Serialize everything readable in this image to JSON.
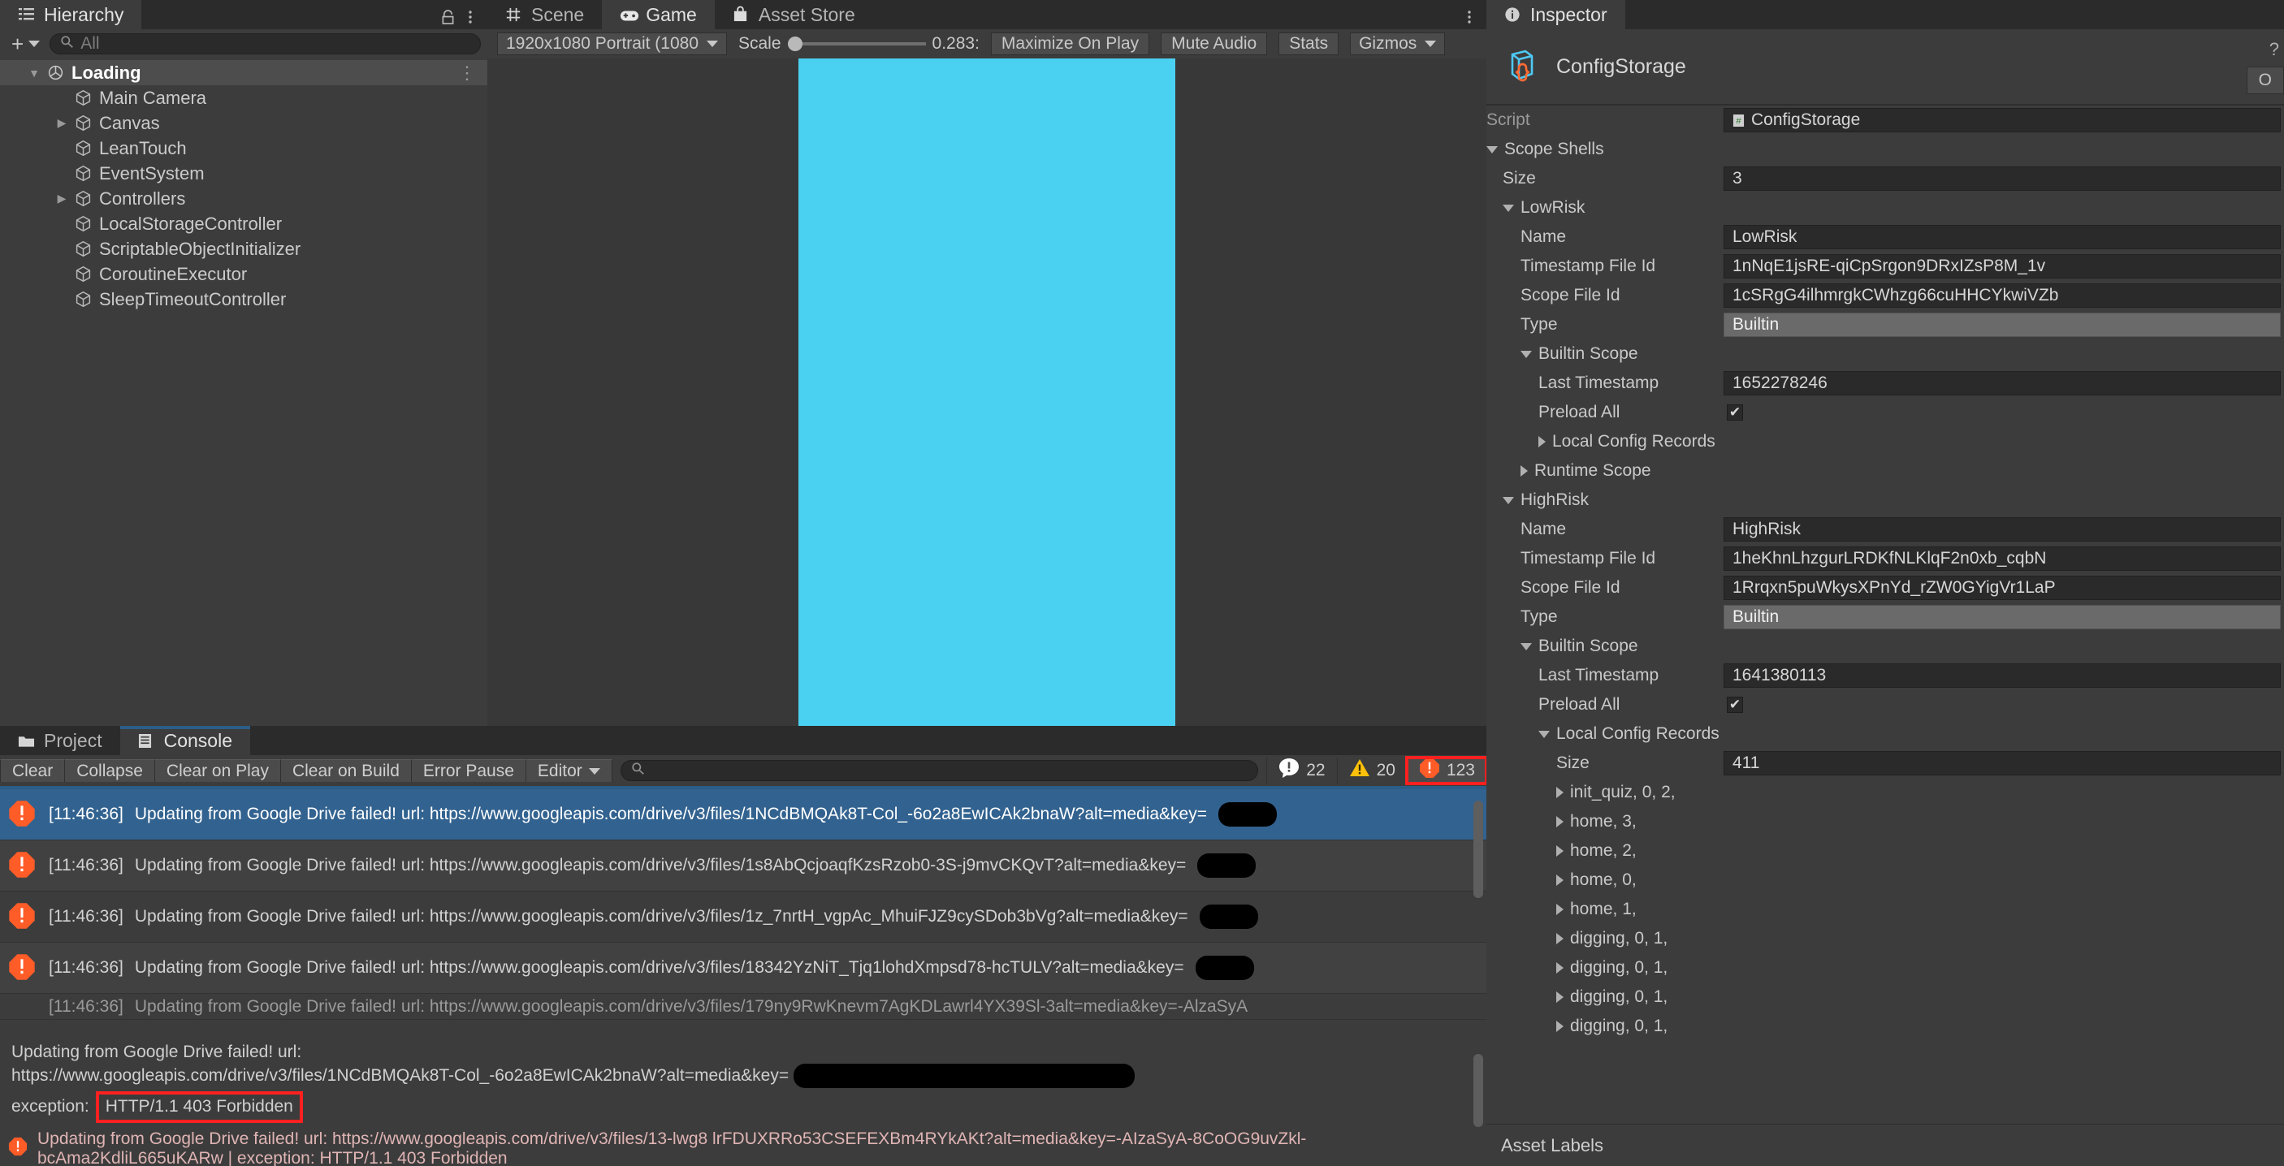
{
  "hierarchy": {
    "tab_label": "Hierarchy",
    "search_placeholder": "All",
    "add_label": "+",
    "items": [
      {
        "label": "Loading",
        "depth": 0,
        "selected": true,
        "expanded": true,
        "has_children": true,
        "icon": "unity-prefab-icon"
      },
      {
        "label": "Main Camera",
        "depth": 1,
        "selected": false,
        "expanded": false,
        "has_children": false,
        "icon": "gameobject-icon"
      },
      {
        "label": "Canvas",
        "depth": 1,
        "selected": false,
        "expanded": false,
        "has_children": true,
        "icon": "gameobject-icon"
      },
      {
        "label": "LeanTouch",
        "depth": 1,
        "selected": false,
        "expanded": false,
        "has_children": false,
        "icon": "gameobject-icon"
      },
      {
        "label": "EventSystem",
        "depth": 1,
        "selected": false,
        "expanded": false,
        "has_children": false,
        "icon": "gameobject-icon"
      },
      {
        "label": "Controllers",
        "depth": 1,
        "selected": false,
        "expanded": false,
        "has_children": true,
        "icon": "gameobject-icon"
      },
      {
        "label": "LocalStorageController",
        "depth": 1,
        "selected": false,
        "expanded": false,
        "has_children": false,
        "icon": "gameobject-icon"
      },
      {
        "label": "ScriptableObjectInitializer",
        "depth": 1,
        "selected": false,
        "expanded": false,
        "has_children": false,
        "icon": "gameobject-icon"
      },
      {
        "label": "CoroutineExecutor",
        "depth": 1,
        "selected": false,
        "expanded": false,
        "has_children": false,
        "icon": "gameobject-icon"
      },
      {
        "label": "SleepTimeoutController",
        "depth": 1,
        "selected": false,
        "expanded": false,
        "has_children": false,
        "icon": "gameobject-icon"
      }
    ]
  },
  "center": {
    "tabs": [
      {
        "label": "Scene",
        "icon": "grid-icon",
        "active": false
      },
      {
        "label": "Game",
        "icon": "gamepad-icon",
        "active": true
      },
      {
        "label": "Asset Store",
        "icon": "store-bag-icon",
        "active": false
      }
    ],
    "toolbar": {
      "resolution": "1920x1080 Portrait (1080",
      "scale_label": "Scale",
      "scale_value": "0.283:",
      "maximize_on_play": "Maximize On Play",
      "mute_audio": "Mute Audio",
      "stats": "Stats",
      "gizmos": "Gizmos"
    },
    "game_canvas_color": "#4ad0f0"
  },
  "console": {
    "tabs": [
      {
        "label": "Project",
        "icon": "folder-icon",
        "active": false
      },
      {
        "label": "Console",
        "icon": "console-lines-icon",
        "active": true
      }
    ],
    "buttons": [
      "Clear",
      "Collapse",
      "Clear on Play",
      "Clear on Build",
      "Error Pause"
    ],
    "editor_dropdown": "Editor",
    "search_placeholder": "",
    "counts": {
      "info": "22",
      "warning": "20",
      "error": "123"
    },
    "error_count_highlight_color": "#ff2020",
    "rows": [
      {
        "time": "[11:46:36]",
        "text": "Updating from Google Drive failed! url: https://www.googleapis.com/drive/v3/files/1NCdBMQAk8T-Col_-6o2a8EwICAk2bnaW?alt=media&key=",
        "redacted": true,
        "selected": true
      },
      {
        "time": "[11:46:36]",
        "text": "Updating from Google Drive failed! url: https://www.googleapis.com/drive/v3/files/1s8AbQcjoaqfKzsRzob0-3S-j9mvCKQvT?alt=media&key=",
        "redacted": true,
        "selected": false
      },
      {
        "time": "[11:46:36]",
        "text": "Updating from Google Drive failed! url: https://www.googleapis.com/drive/v3/files/1z_7nrtH_vgpAc_MhuiFJZ9cySDob3bVg?alt=media&key=",
        "redacted": true,
        "selected": false
      },
      {
        "time": "[11:46:36]",
        "text": "Updating from Google Drive failed! url: https://www.googleapis.com/drive/v3/files/18342YzNiT_Tjq1lohdXmpsd78-hcTULV?alt=media&key=",
        "redacted": true,
        "selected": false
      },
      {
        "time": "[11:46:36]",
        "text": "Updating from Google Drive failed! url: https://www.googleapis.com/drive/v3/files/179ny9RwKnevm7AgKDLawrl4YX39Sl-3alt=media&key=-AlzaSyA",
        "redacted": false,
        "selected": false
      }
    ],
    "detail": {
      "line1": "Updating from Google Drive failed! url:",
      "line2": "https://www.googleapis.com/drive/v3/files/1NCdBMQAk8T-Col_-6o2a8EwICAk2bnaW?alt=media&key=",
      "line3_prefix": "exception:",
      "line3_boxed": "HTTP/1.1 403 Forbidden"
    },
    "statusbar": "Updating from Google Drive failed! url: https://www.googleapis.com/drive/v3/files/13-lwg8 lrFDUXRRo53CSEFEXBm4RYkAKt?alt=media&key=-AIzaSyA-8CoOG9uvZkl-bcAma2KdliL665uKARw | exception: HTTP/1.1 403 Forbidden"
  },
  "inspector": {
    "tab_label": "Inspector",
    "object_name": "ConfigStorage",
    "open_button": "O",
    "script_label": "Script",
    "script_value": "ConfigStorage",
    "scope_shells_label": "Scope Shells",
    "size_label": "Size",
    "size_value": "3",
    "shells": [
      {
        "header": "LowRisk",
        "name_label": "Name",
        "name_value": "LowRisk",
        "timestamp_label": "Timestamp File Id",
        "timestamp_value": "1nNqE1jsRE-qiCpSrgon9DRxIZsP8M_1v",
        "scope_label": "Scope File Id",
        "scope_value": "1cSRgG4ilhmrgkCWhzg66cuHHCYkwiVZb",
        "type_label": "Type",
        "type_value": "Builtin",
        "builtin_scope_label": "Builtin Scope",
        "last_timestamp_label": "Last Timestamp",
        "last_timestamp_value": "1652278246",
        "preload_all_label": "Preload All",
        "preload_all_checked": true,
        "local_config_label": "Local Config Records",
        "local_config_expanded": false,
        "runtime_scope_label": "Runtime Scope"
      },
      {
        "header": "HighRisk",
        "name_label": "Name",
        "name_value": "HighRisk",
        "timestamp_label": "Timestamp File Id",
        "timestamp_value": "1heKhnLhzgurLRDKfNLKlqF2n0xb_cqbN",
        "scope_label": "Scope File Id",
        "scope_value": "1Rrqxn5puWkysXPnYd_rZW0GYigVr1LaP",
        "type_label": "Type",
        "type_value": "Builtin",
        "builtin_scope_label": "Builtin Scope",
        "last_timestamp_label": "Last Timestamp",
        "last_timestamp_value": "1641380113",
        "preload_all_label": "Preload All",
        "preload_all_checked": true,
        "local_config_label": "Local Config Records",
        "local_config_expanded": true,
        "records_size_label": "Size",
        "records_size_value": "411",
        "records": [
          "init_quiz,  0, 2,",
          "home,  3,",
          "home,  2,",
          "home,  0,",
          "home,  1,",
          "digging,  0, 1,",
          "digging,  0, 1,",
          "digging,  0, 1,",
          "digging,  0, 1,"
        ]
      }
    ],
    "asset_labels": "Asset Labels"
  }
}
